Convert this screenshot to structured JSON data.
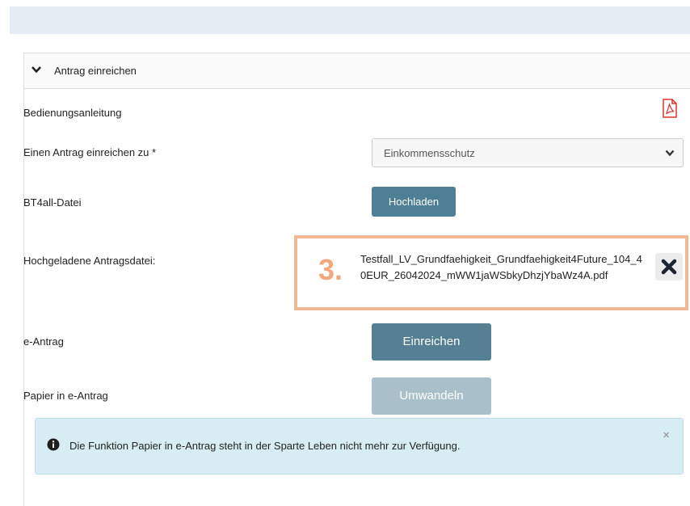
{
  "panel": {
    "title": "Antrag einreichen",
    "rows": {
      "manual_label": "Bedienungsanleitung",
      "apply_for_label": "Einen Antrag einreichen zu *",
      "bt4all_label": "BT4all-Datei",
      "uploaded_label": "Hochgeladene Antragsdatei:",
      "e_antrag_label": "e-Antrag",
      "paper_label": "Papier in e-Antrag"
    },
    "select": {
      "value": "Einkommensschutz"
    },
    "buttons": {
      "upload": "Hochladen",
      "submit": "Einreichen",
      "convert": "Umwandeln"
    },
    "uploaded_file": {
      "step": "3.",
      "filename": "Testfall_LV_Grundfaehigkeit_Grundfaehigkeit4Future_104_40EUR_26042024_mWW1jaWSbkyDhzjYbaWz4A.pdf"
    },
    "info": {
      "message": "Die Funktion Papier in e-Antrag steht in der Sparte Leben nicht mehr zur Verfügung.",
      "close": "×"
    }
  },
  "icons": {
    "chevron": "chevron-down-icon",
    "pdf": "pdf-icon",
    "remove": "close-icon",
    "info": "info-icon"
  },
  "colors": {
    "primary_button": "#557f93",
    "disabled_button": "#a9c0cb",
    "highlight_border": "#f0b895",
    "step_number": "#f2a77d",
    "info_background": "#d8edf3",
    "pdf_red": "#d9352b"
  }
}
